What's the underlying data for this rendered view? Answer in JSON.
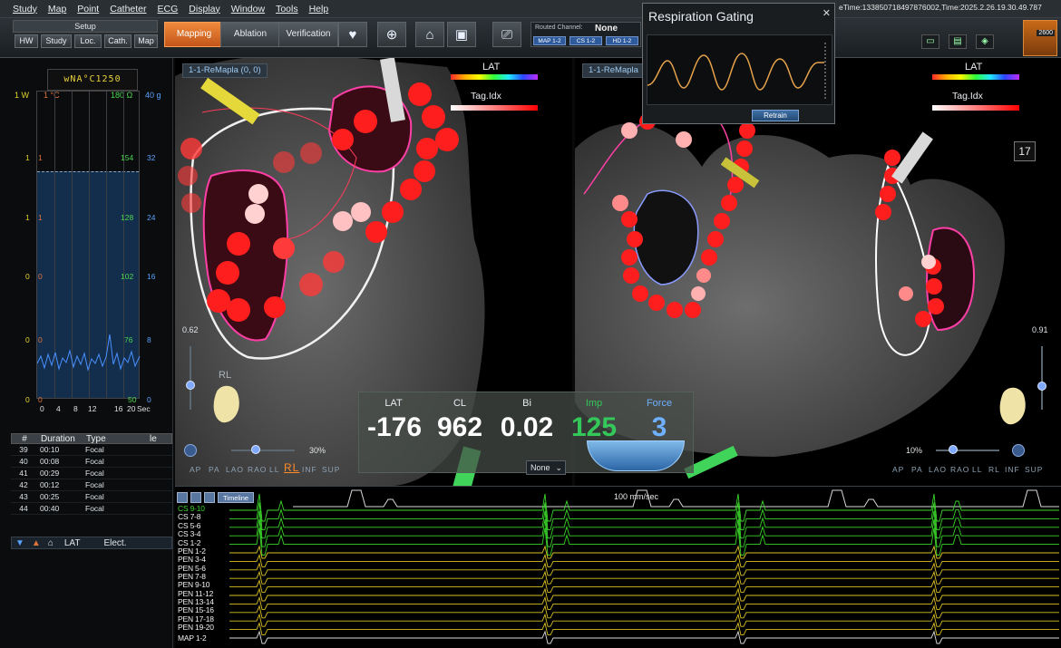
{
  "menu": [
    "Study",
    "Map",
    "Point",
    "Catheter",
    "ECG",
    "Display",
    "Window",
    "Tools",
    "Help"
  ],
  "title_time": "eTime:133850718497876002,Time:2025.2.26.19.30.49.787",
  "toolbar": {
    "setup_label": "Setup",
    "setup_buttons": [
      "HW",
      "Study",
      "Loc.",
      "Cath.",
      "Map"
    ],
    "modes": [
      "Mapping",
      "Ablation",
      "Verification"
    ],
    "active_mode": "Mapping",
    "routed_channel_label": "Routed Channel:",
    "routed_channel_value": "None",
    "channel_chips": [
      "MAP 1-2",
      "CS 1-2",
      "HD 1-2"
    ],
    "proximity_value": "2600"
  },
  "left_panel": {
    "digital_readout": "wNA°C1250",
    "axis_headers": {
      "left": "1 W",
      "temp": "1 °C",
      "ohm": "180 Ω",
      "grams": "40 g"
    },
    "left_ticks": [
      "1",
      "1",
      "0",
      "0",
      "0"
    ],
    "temp_ticks": [
      "1",
      "1",
      "0",
      "0",
      "0"
    ],
    "ohm_ticks": [
      "154",
      "128",
      "102",
      "76",
      "50"
    ],
    "grams_ticks": [
      "32",
      "24",
      "16",
      "8",
      "0"
    ],
    "x_ticks": [
      "0",
      "4",
      "8",
      "12",
      "16",
      "20"
    ],
    "x_unit": "Sec",
    "events_table": {
      "headers": [
        "#",
        "Duration",
        "Type",
        "le"
      ],
      "rows": [
        [
          "39",
          "00:10",
          "Focal"
        ],
        [
          "40",
          "00:08",
          "Focal"
        ],
        [
          "41",
          "00:29",
          "Focal"
        ],
        [
          "42",
          "00:12",
          "Focal"
        ],
        [
          "43",
          "00:25",
          "Focal"
        ],
        [
          "44",
          "00:40",
          "Focal"
        ]
      ]
    },
    "lat_headers": [
      "LAT",
      "Elect."
    ]
  },
  "view_left": {
    "map_label": "1-1-ReMapla (0, 0)",
    "lat_label": "LAT",
    "tag_label": "Tag.Idx",
    "slider_value": "0.62",
    "orientation_label": "RL",
    "zoom_pct": "30%",
    "view_buttons": [
      "AP",
      "PA",
      "LAO",
      "RAO",
      "LL",
      "RL",
      "INF",
      "SUP"
    ],
    "active_view": "RL"
  },
  "view_right": {
    "map_label": "1-1-ReMapla",
    "lat_label": "LAT",
    "tag_label": "Tag.Idx",
    "slider_value": "0.91",
    "zoom_pct": "10%",
    "counter": "17",
    "view_buttons": [
      "AP",
      "PA",
      "LAO",
      "RAO",
      "LL",
      "RL",
      "INF",
      "SUP"
    ]
  },
  "readout": {
    "labels": [
      "LAT",
      "CL",
      "Bi",
      "Imp",
      "Force"
    ],
    "values": [
      "-176",
      "962",
      "0.02",
      "125",
      "3"
    ],
    "colors": {
      "lat": "#ffffff",
      "cl": "#ffffff",
      "bi": "#ffffff",
      "imp": "#34c759",
      "force": "#6fb0ff"
    },
    "dropdown_value": "None"
  },
  "respiration": {
    "title": "Respiration Gating",
    "retrain_label": "Retrain"
  },
  "ecg": {
    "tool_label": "Timeline",
    "speed_label": "100 mm/sec",
    "channels": [
      "CS 9-10",
      "CS 7-8",
      "CS 5-6",
      "CS 3-4",
      "CS 1-2",
      "PEN 1-2",
      "PEN 3-4",
      "PEN 5-6",
      "PEN 7-8",
      "PEN 9-10",
      "PEN 11-12",
      "PEN 13-14",
      "PEN 15-16",
      "PEN 17-18",
      "PEN 19-20",
      "MAP 1-2"
    ],
    "colors": {
      "cs": "#3bd42a",
      "pen": "#d8c024",
      "map": "#d9d9d9"
    }
  }
}
